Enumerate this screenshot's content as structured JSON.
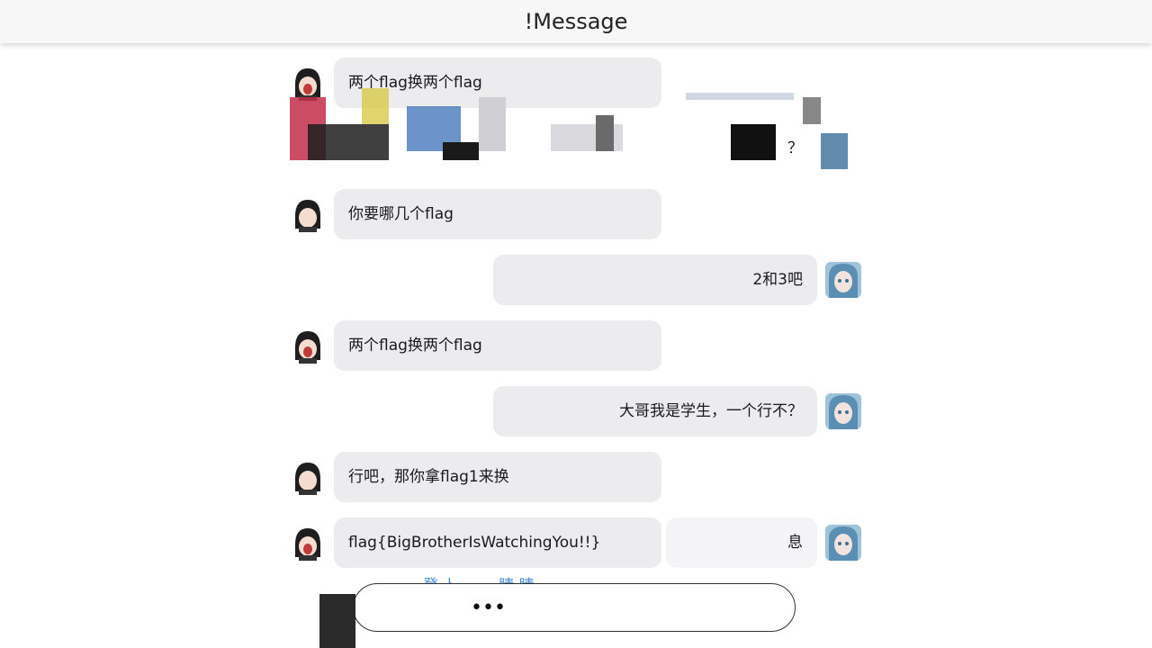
{
  "app": {
    "title": "!Message"
  },
  "messages": [
    {
      "side": "left",
      "text": "两个flag换两个flag"
    },
    {
      "side": "right",
      "text": "？"
    },
    {
      "side": "left",
      "text": "你要哪几个flag"
    },
    {
      "side": "right",
      "text": "2和3吧"
    },
    {
      "side": "left",
      "text": "两个flag换两个flag"
    },
    {
      "side": "right",
      "text": "大哥我是学生，一个行不？"
    },
    {
      "side": "left",
      "text": "行吧，那你拿flag1来换"
    },
    {
      "side": "left",
      "text": "flag{BigBrotherIsWatchingYou!!}"
    },
    {
      "side": "right",
      "text": "息"
    }
  ],
  "composer": {
    "value": "•••"
  },
  "overlay": {
    "link_text": "登 卜 …… 睛  睛"
  },
  "colors": {
    "bubble": "#ececef",
    "titlebar": "#f7f7f7",
    "link": "#4a90d9"
  }
}
